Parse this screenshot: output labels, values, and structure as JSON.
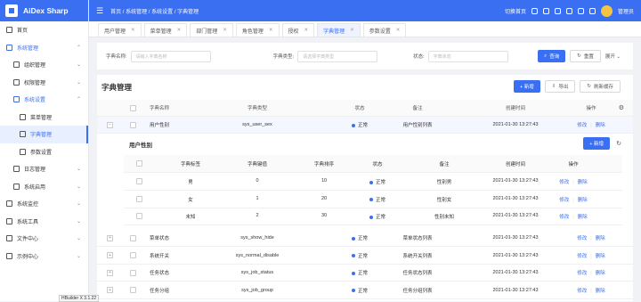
{
  "app": {
    "title": "AiDex Sharp"
  },
  "breadcrumb": [
    "首页",
    "系统管理",
    "系统设置",
    "字典管理"
  ],
  "topbar": {
    "workspace": "切换首页",
    "user": "管理员"
  },
  "sidebar": {
    "items": [
      {
        "label": "首页",
        "level": 0,
        "icon": "home-icon"
      },
      {
        "label": "系统管理",
        "level": 0,
        "icon": "gear-icon",
        "open": true
      },
      {
        "label": "组织管理",
        "level": 1,
        "icon": "grid-icon"
      },
      {
        "label": "权限管理",
        "level": 1,
        "icon": "user-icon"
      },
      {
        "label": "系统设置",
        "level": 1,
        "icon": "settings-icon",
        "open": true
      },
      {
        "label": "菜单管理",
        "level": 2,
        "icon": "list-icon"
      },
      {
        "label": "字典管理",
        "level": 2,
        "icon": "book-icon",
        "active": true
      },
      {
        "label": "参数设置",
        "level": 2,
        "icon": "edit-icon"
      },
      {
        "label": "日志管理",
        "level": 1,
        "icon": "calendar-icon"
      },
      {
        "label": "系统启用",
        "level": 1,
        "icon": "box-icon"
      },
      {
        "label": "系统监控",
        "level": 0,
        "icon": "monitor-icon"
      },
      {
        "label": "系统工具",
        "level": 0,
        "icon": "tool-icon"
      },
      {
        "label": "文件中心",
        "level": 0,
        "icon": "folder-icon"
      },
      {
        "label": "示例中心",
        "level": 0,
        "icon": "sample-icon"
      }
    ]
  },
  "tabs": [
    "用户管理",
    "菜单管理",
    "部门管理",
    "角色管理",
    "授权",
    "字典管理",
    "参数设置"
  ],
  "filter": {
    "name_label": "字典名称:",
    "name_placeholder": "请输入字典名称",
    "type_label": "字典类型:",
    "type_placeholder": "请选择字典类型",
    "status_label": "状态:",
    "status_placeholder": "字典状态",
    "search": "查询",
    "reset": "重置",
    "expand": "展开"
  },
  "card": {
    "title": "字典管理",
    "add": "+ 新增",
    "export": "导出",
    "refresh": "刷新缓存"
  },
  "table": {
    "headers": [
      "字典名称",
      "字典类型",
      "状态",
      "备注",
      "创建时间",
      "操作"
    ],
    "rows": [
      {
        "name": "用户性别",
        "type": "sys_user_sex",
        "status": "正常",
        "remark": "用户性别列表",
        "time": "2021-01-30 13:27:43",
        "expanded": true
      },
      {
        "name": "菜单状态",
        "type": "sys_show_hide",
        "status": "正常",
        "remark": "菜单状态列表",
        "time": "2021-01-30 13:27:43"
      },
      {
        "name": "系统开关",
        "type": "sys_normal_disable",
        "status": "正常",
        "remark": "系统开关列表",
        "time": "2021-01-30 13:27:43"
      },
      {
        "name": "任务状态",
        "type": "sys_job_status",
        "status": "正常",
        "remark": "任务状态列表",
        "time": "2021-01-30 13:27:43"
      },
      {
        "name": "任务分组",
        "type": "sys_job_group",
        "status": "正常",
        "remark": "任务分组列表",
        "time": "2021-01-30 13:27:43"
      }
    ],
    "edit": "修改",
    "delete": "删除"
  },
  "nested": {
    "title": "用户性别",
    "add": "+ 新增",
    "headers": [
      "字典标签",
      "字典键值",
      "字典排序",
      "状态",
      "备注",
      "创建时间",
      "操作"
    ],
    "rows": [
      {
        "label": "男",
        "value": "0",
        "sort": "10",
        "status": "正常",
        "remark": "性别男",
        "time": "2021-01-30 13:27:43"
      },
      {
        "label": "女",
        "value": "1",
        "sort": "20",
        "status": "正常",
        "remark": "性别女",
        "time": "2021-01-30 13:27:43"
      },
      {
        "label": "未知",
        "value": "2",
        "sort": "30",
        "status": "正常",
        "remark": "性别未知",
        "time": "2021-01-30 13:27:43"
      }
    ]
  },
  "tooltip": "HBuilder X 3.1.22"
}
